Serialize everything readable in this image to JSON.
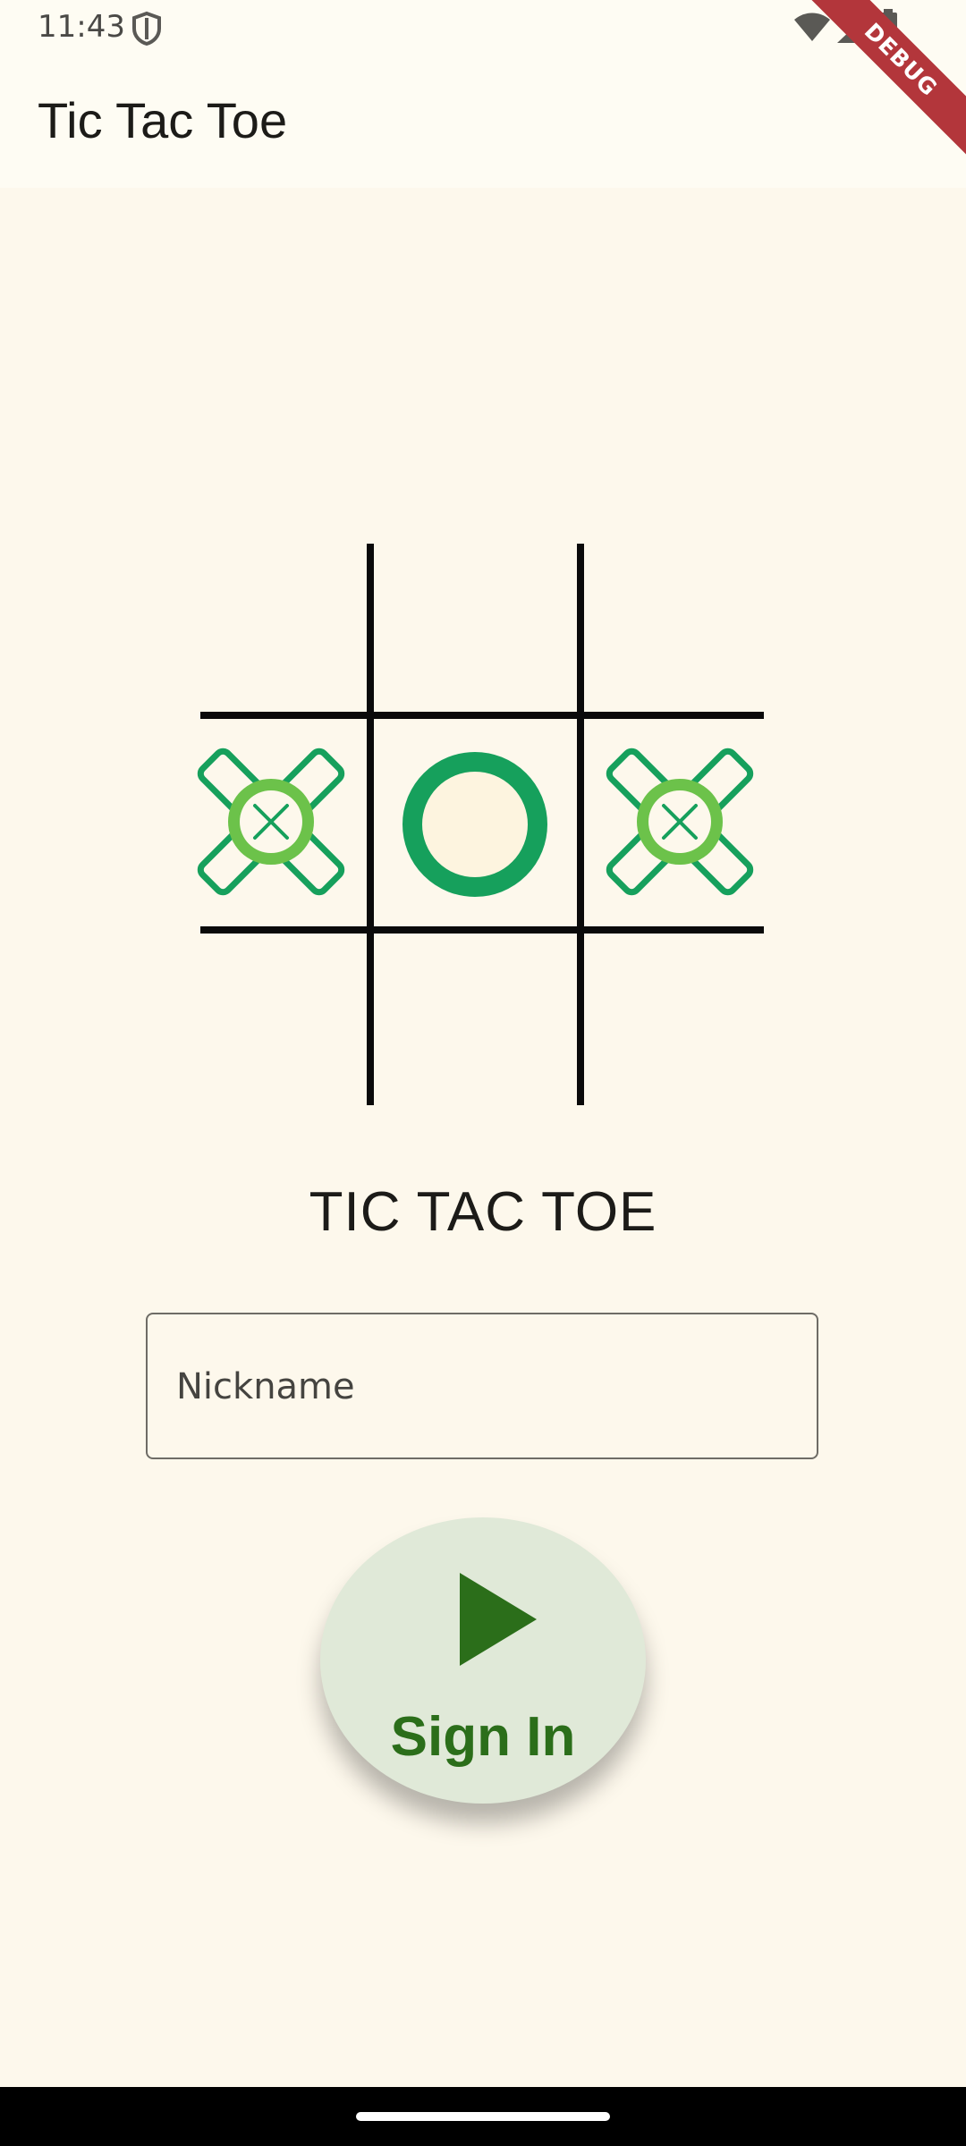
{
  "status_bar": {
    "time": "11:43",
    "icons": [
      "shield-icon",
      "wifi-icon",
      "signal-icon",
      "battery-icon"
    ]
  },
  "app_bar": {
    "title": "Tic Tac Toe"
  },
  "debug_banner": {
    "label": "DEBUG",
    "color": "#b3363b"
  },
  "board": {
    "cells": [
      [
        "",
        "",
        ""
      ],
      [
        "X",
        "O",
        "X"
      ],
      [
        "",
        "",
        ""
      ]
    ],
    "mark_color": "#16a05c",
    "accent_color": "#6cc24a"
  },
  "game_title": "TIC TAC TOE",
  "nickname_field": {
    "placeholder": "Nickname",
    "value": ""
  },
  "signin_button": {
    "label": "Sign In",
    "icon": "play-icon",
    "color": "#2b6e1a",
    "background": "#e0e9d8"
  }
}
